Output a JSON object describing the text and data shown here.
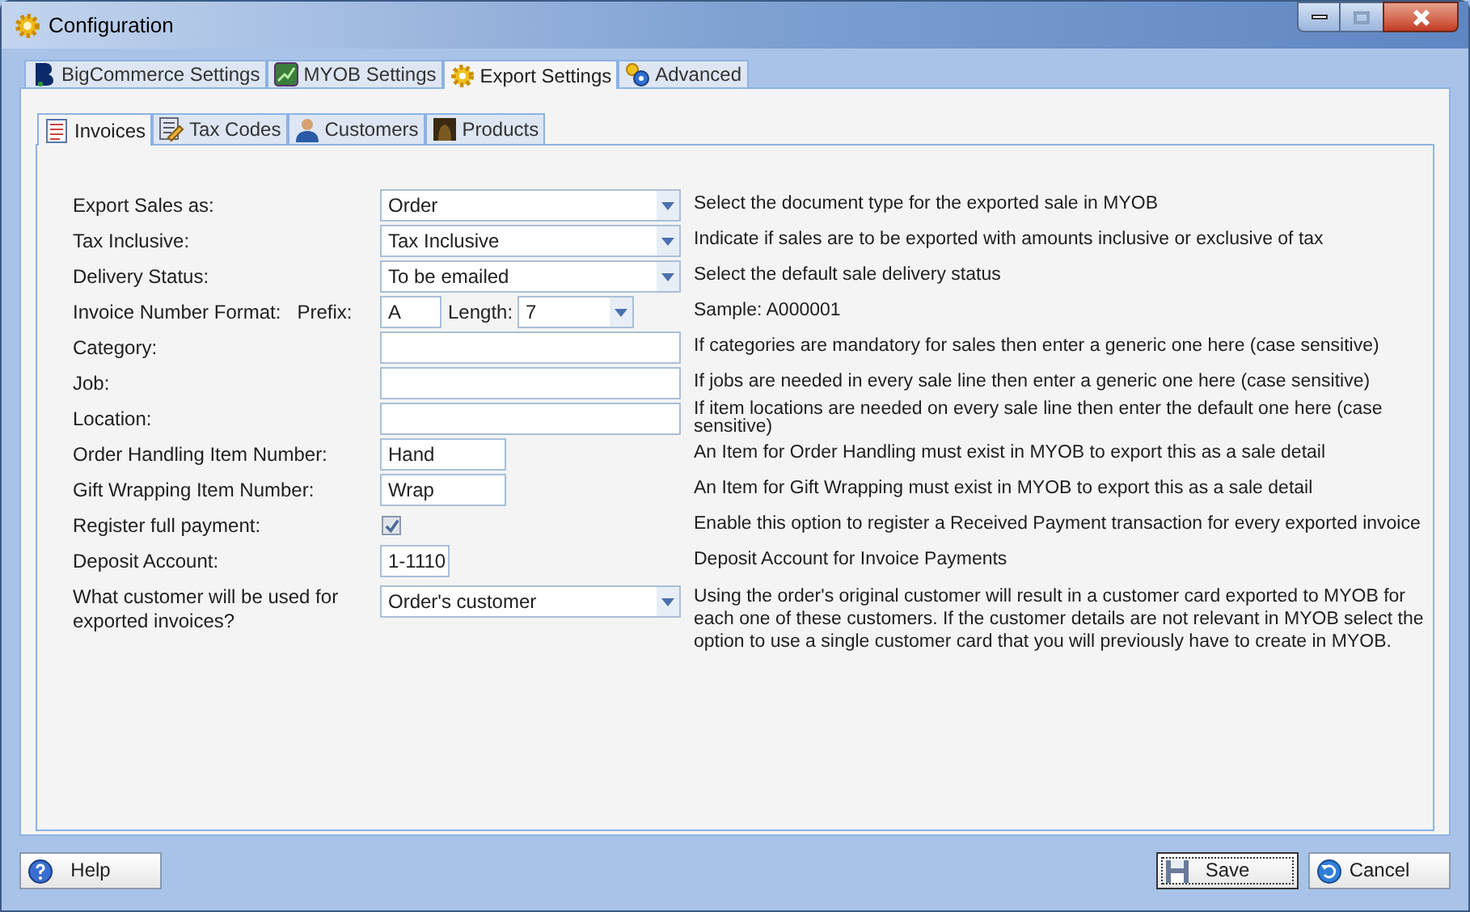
{
  "window": {
    "title": "Configuration"
  },
  "tabs": [
    {
      "label": "BigCommerce Settings",
      "selected": false
    },
    {
      "label": "MYOB Settings",
      "selected": false
    },
    {
      "label": "Export Settings",
      "selected": true
    },
    {
      "label": "Advanced",
      "selected": false
    }
  ],
  "subtabs": [
    {
      "label": "Invoices",
      "selected": true
    },
    {
      "label": "Tax Codes",
      "selected": false
    },
    {
      "label": "Customers",
      "selected": false
    },
    {
      "label": "Products",
      "selected": false
    }
  ],
  "rows": [
    {
      "kind": "select",
      "label": "Export Sales as:",
      "value": "Order",
      "description": "Select the document type for the exported sale in MYOB"
    },
    {
      "kind": "select",
      "label": "Tax Inclusive:",
      "value": "Tax Inclusive",
      "description": "Indicate if sales are to be exported with amounts inclusive or exclusive of tax"
    },
    {
      "kind": "select",
      "label": "Delivery Status:",
      "value": "To be emailed",
      "description": "Select the default sale delivery status"
    },
    {
      "kind": "format",
      "label": "Invoice Number Format:",
      "prefix_label": "Prefix:",
      "prefix": "A",
      "length_label": "Length:",
      "length": "7",
      "description": "Sample: A000001"
    },
    {
      "kind": "text",
      "label": "Category:",
      "description": "If categories are mandatory for sales then enter a generic one here (case sensitive)"
    },
    {
      "kind": "text",
      "label": "Job:",
      "description": "If jobs are needed in every sale line then enter a generic one here (case sensitive)"
    },
    {
      "kind": "text",
      "label": "Location:",
      "description": "If item locations are needed on every sale line then enter the default one here (case sensitive)"
    },
    {
      "kind": "short",
      "label": "Order Handling Item Number:",
      "value": "Hand",
      "description": "An Item for Order Handling must exist in MYOB to export this as a sale detail"
    },
    {
      "kind": "short",
      "label": "Gift Wrapping Item Number:",
      "value": "Wrap",
      "description": "An Item for Gift Wrapping must exist in MYOB to export this as a sale detail"
    },
    {
      "kind": "checkbox",
      "label": "Register full payment:",
      "checked": true,
      "description": "Enable this option to register a Received Payment transaction for every exported invoice"
    },
    {
      "kind": "tiny",
      "label": "Deposit Account:",
      "value": "1-1110",
      "description": "Deposit Account for Invoice Payments"
    },
    {
      "kind": "select",
      "label": "What customer will be used for exported invoices?",
      "value": "Order's customer",
      "description": "Using the order's original customer will result in a customer card exported to MYOB for each one of these customers. If the customer details are not relevant in MYOB select the option to use a single customer card that you will previously have to create in MYOB."
    }
  ],
  "buttons": [
    {
      "kind": "help",
      "label": "Help"
    },
    {
      "kind": "save",
      "label": "Save"
    },
    {
      "kind": "cancel",
      "label": "Cancel"
    }
  ]
}
